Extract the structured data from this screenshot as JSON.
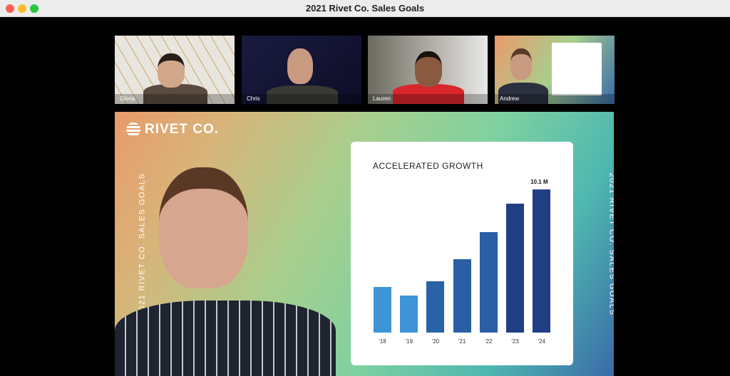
{
  "window": {
    "title": "2021 Rivet Co. Sales Goals"
  },
  "participants": [
    {
      "name": "Gloria"
    },
    {
      "name": "Chris"
    },
    {
      "name": "Lauren"
    },
    {
      "name": "Andrew"
    }
  ],
  "stage": {
    "logo": "RIVET CO.",
    "side_text": "2021 RIVET CO. SALES GOALS"
  },
  "chart_data": {
    "type": "bar",
    "title": "ACCELERATED GROWTH",
    "categories": [
      "'18",
      "'19",
      "'20",
      "'21",
      "'22",
      "'23",
      "'24"
    ],
    "values": [
      3.2,
      2.6,
      3.6,
      5.2,
      7.1,
      9.1,
      10.1
    ],
    "units": "M",
    "data_labels": {
      "'24": "10.1 M"
    },
    "colors": [
      "#3d94d6",
      "#3d94d6",
      "#2a62a8",
      "#2a5ea5",
      "#2a5ea5",
      "#213f85",
      "#213f85"
    ]
  }
}
